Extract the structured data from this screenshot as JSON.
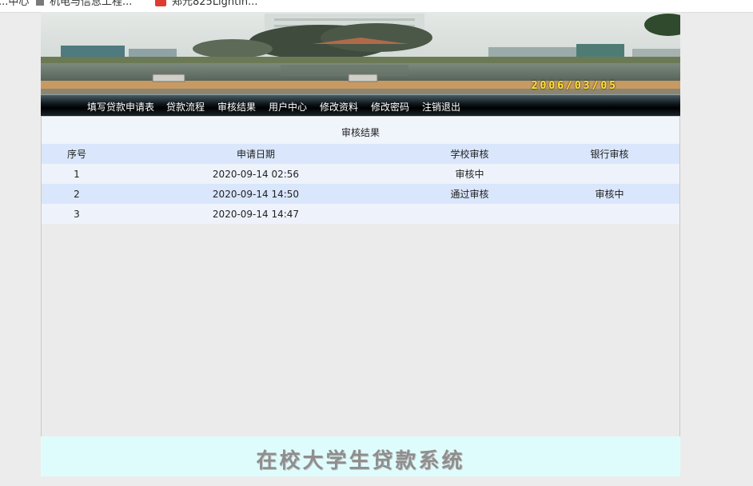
{
  "browser": {
    "bookmarks": [
      "...中心",
      "机电与信息工程...",
      "郑元825Lightin..."
    ]
  },
  "banner": {
    "date_stamp": "2006/03/05"
  },
  "nav": {
    "items": [
      "填写贷款申请表",
      "贷款流程",
      "审核结果",
      "用户中心",
      "修改资料",
      "修改密码",
      "注销退出"
    ]
  },
  "results": {
    "title": "审核结果",
    "headers": {
      "index": "序号",
      "date": "申请日期",
      "school": "学校审核",
      "bank": "银行审核"
    },
    "rows": [
      {
        "index": "1",
        "date": "2020-09-14 02:56",
        "school": "审核中",
        "bank": ""
      },
      {
        "index": "2",
        "date": "2020-09-14 14:50",
        "school": "通过审核",
        "bank": "审核中"
      },
      {
        "index": "3",
        "date": "2020-09-14 14:47",
        "school": "",
        "bank": ""
      }
    ]
  },
  "footer": {
    "title": "在校大学生贷款系统"
  },
  "colors": {
    "nav_bg": "#000000",
    "table_header": "#d9e6fb",
    "table_row_light": "#eef3fb",
    "footer_bg": "#dffcfc",
    "date_stamp": "#ffe933"
  }
}
